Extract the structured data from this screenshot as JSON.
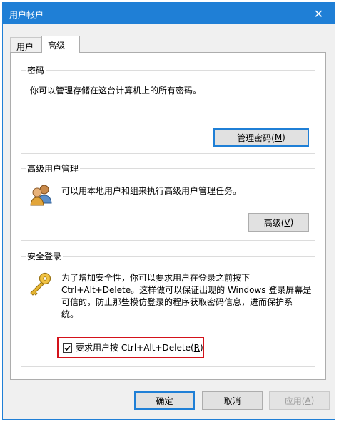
{
  "window": {
    "title": "用户帐户",
    "close_glyph": "✕"
  },
  "tabs": [
    {
      "label": "用户",
      "active": false
    },
    {
      "label": "高级",
      "active": true
    }
  ],
  "password_group": {
    "legend": "密码",
    "description": "你可以管理存储在这台计算机上的所有密码。",
    "button": {
      "label": "管理密码(",
      "key": "M",
      "suffix": ")"
    }
  },
  "advanced_group": {
    "legend": "高级用户管理",
    "description": "可以用本地用户和组来执行高级用户管理任务。",
    "button": {
      "label": "高级(",
      "key": "V",
      "suffix": ")"
    }
  },
  "secure_group": {
    "legend": "安全登录",
    "description_lines": [
      "为了增加安全性，你可以要求用户在登录之前按下",
      "Ctrl+Alt+Delete。这样做可以保证出现的 Windows 登录屏幕是",
      "可信的，防止那些模仿登录的程序获取密码信息，进而保护系",
      "统。"
    ],
    "checkbox": {
      "label": "要求用户按 Ctrl+Alt+Delete(",
      "key": "R",
      "suffix": ")",
      "checked": true
    }
  },
  "footer": {
    "ok": "确定",
    "cancel": "取消",
    "apply": {
      "label": "应用(",
      "key": "A",
      "suffix": ")",
      "disabled": true
    }
  },
  "colors": {
    "titlebar": "#1f7fd6",
    "highlight": "#d3121a",
    "default_button_border": "#1f7fd6"
  }
}
